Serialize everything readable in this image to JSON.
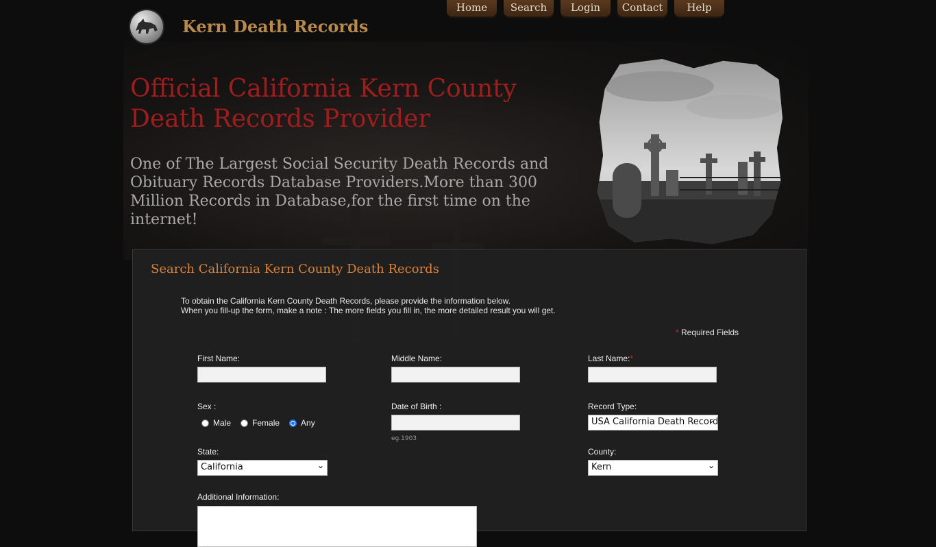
{
  "site": {
    "title": "Kern Death Records"
  },
  "nav": [
    {
      "label": "Home"
    },
    {
      "label": "Search"
    },
    {
      "label": "Login"
    },
    {
      "label": "Contact"
    },
    {
      "label": "Help"
    }
  ],
  "hero": {
    "headline": "Official California Kern County Death Records Provider",
    "tagline": "One of The Largest Social Security Death Records and Obituary Records Database Providers.More than 300 Million Records in Database,for the first time on the internet!"
  },
  "search_panel": {
    "title": "Search California Kern County Death Records",
    "intro_line1": "To obtain the California Kern County Death Records, please provide the information below.",
    "intro_line2": "When you fill-up the form, make a note : The more fields you fill in, the more detailed result you will get.",
    "required_star": "*",
    "required_text": "Required Fields",
    "fields": {
      "first_name": {
        "label": "First Name:",
        "value": ""
      },
      "middle_name": {
        "label": "Middle Name:",
        "value": ""
      },
      "last_name": {
        "label": "Last Name:",
        "value": ""
      },
      "sex": {
        "label": "Sex :",
        "options": [
          "Male",
          "Female",
          "Any"
        ],
        "selected": "Any"
      },
      "dob": {
        "label": "Date of Birth :",
        "value": "",
        "hint": "eg.1903"
      },
      "record_type": {
        "label": "Record Type:",
        "value": "USA California Death Records"
      },
      "state": {
        "label": "State:",
        "value": "California"
      },
      "county": {
        "label": "County:",
        "value": "Kern"
      },
      "additional": {
        "label": "Additional Information:",
        "value": ""
      }
    }
  },
  "colors": {
    "accent": "#b98a4c",
    "headline": "#a01d1d",
    "panel_title": "#d9823a",
    "required": "#cc2a2a"
  }
}
